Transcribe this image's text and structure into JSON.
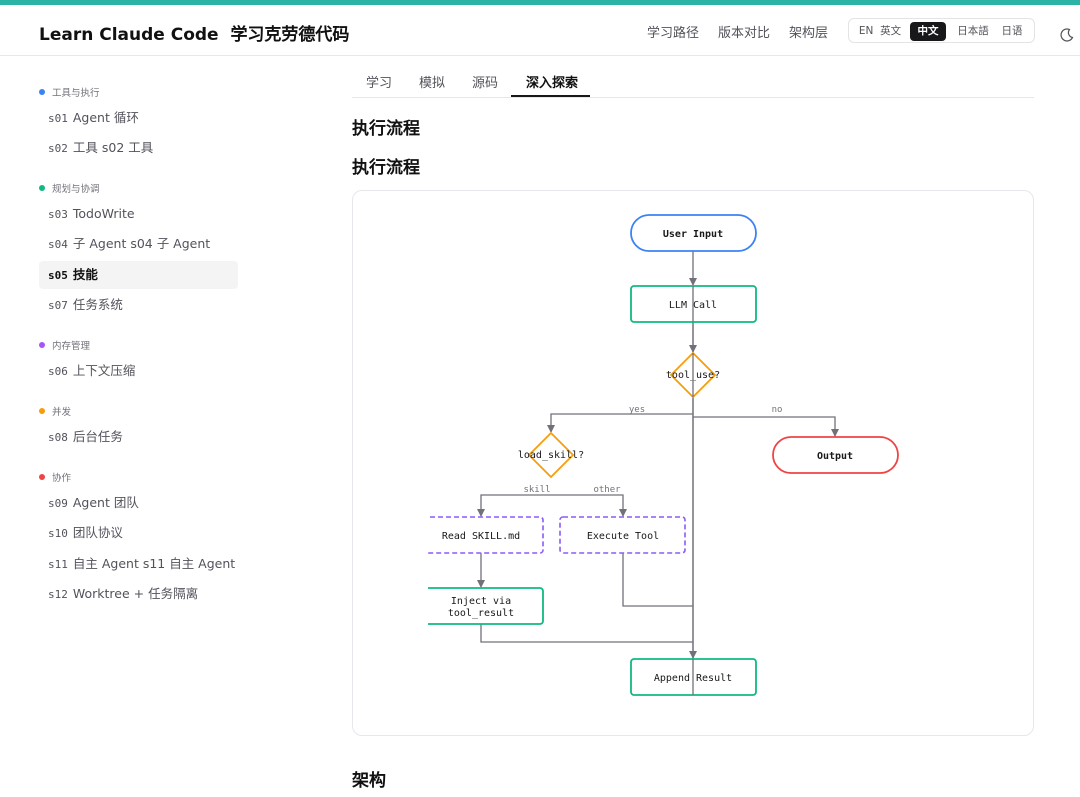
{
  "header": {
    "brand": "Learn Claude Code",
    "brand_cn": "学习克劳德代码",
    "nav": [
      "学习路径",
      "版本对比",
      "架构层"
    ],
    "lang": [
      {
        "code": "EN",
        "label": "英文",
        "active": false
      },
      {
        "code": "",
        "label": "中文",
        "active": true
      },
      {
        "code": "",
        "label": "日本語",
        "active": false
      },
      {
        "code": "",
        "label": "日语",
        "active": false
      }
    ]
  },
  "sidebar": {
    "groups": [
      {
        "label": "工具与执行",
        "color": "#3b82f6",
        "items": [
          {
            "code": "s01",
            "label": "Agent 循环",
            "active": false
          },
          {
            "code": "s02",
            "label": "工具  s02 工具",
            "active": false
          }
        ]
      },
      {
        "label": "规划与协调",
        "color": "#10b981",
        "items": [
          {
            "code": "s03",
            "label": "TodoWrite",
            "active": false
          },
          {
            "code": "s04",
            "label": "子 Agent  s04 子 Agent",
            "active": false
          },
          {
            "code": "s05",
            "label": "技能",
            "active": true
          },
          {
            "code": "s07",
            "label": "任务系统",
            "active": false
          }
        ]
      },
      {
        "label": "内存管理",
        "color": "#a855f7",
        "items": [
          {
            "code": "s06",
            "label": "上下文压缩",
            "active": false
          }
        ]
      },
      {
        "label": "并发",
        "color": "#f59e0b",
        "items": [
          {
            "code": "s08",
            "label": "后台任务",
            "active": false
          }
        ]
      },
      {
        "label": "协作",
        "color": "#ef4444",
        "items": [
          {
            "code": "s09",
            "label": "Agent 团队",
            "active": false
          },
          {
            "code": "s10",
            "label": "团队协议",
            "active": false
          },
          {
            "code": "s11",
            "label": "自主 Agent  s11 自主 Agent",
            "active": false
          },
          {
            "code": "s12",
            "label": "Worktree + 任务隔离",
            "active": false
          }
        ]
      }
    ]
  },
  "tabs": [
    {
      "label": "学习",
      "active": false
    },
    {
      "label": "模拟",
      "active": false
    },
    {
      "label": "源码",
      "active": false
    },
    {
      "label": "深入探索",
      "active": true
    }
  ],
  "main": {
    "heading1": "执行流程",
    "heading2": "执行流程",
    "heading3": "架构"
  },
  "flow": {
    "nodes": {
      "user_input": "User Input",
      "llm_call": "LLM Call",
      "tool_use": "tool_use?",
      "output": "Output",
      "load_skill": "load_skill?",
      "read_skill": "Read SKILL.md",
      "execute_tool": "Execute Tool",
      "inject_1": "Inject via",
      "inject_2": "tool_result",
      "append_result": "Append Result"
    },
    "edges": {
      "yes": "yes",
      "no": "no",
      "skill": "skill",
      "other": "other"
    },
    "colors": {
      "start": "#3b82f6",
      "process": "#10b981",
      "decision": "#f59e0b",
      "end": "#ef4444",
      "subprocess": "#8b5cf6",
      "edge": "#71717a"
    }
  }
}
